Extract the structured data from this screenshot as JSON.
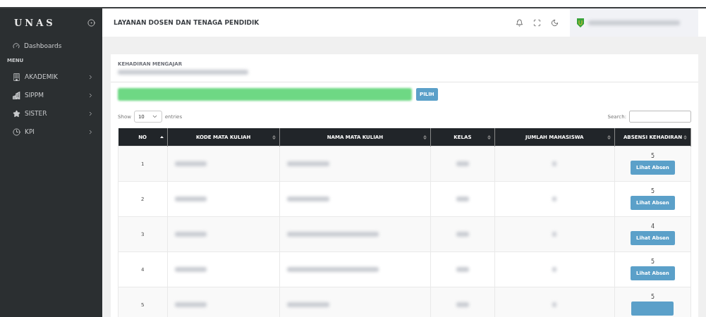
{
  "sidebar": {
    "logo": "UNAS",
    "dashboard": "Dashboards",
    "section": "MENU",
    "items": [
      {
        "label": "AKADEMIK",
        "kind": "building"
      },
      {
        "label": "SIPPM",
        "kind": "office"
      },
      {
        "label": "SISTER",
        "kind": "star"
      },
      {
        "label": "KPI",
        "kind": "clock"
      }
    ]
  },
  "header": {
    "title": "LAYANAN DOSEN DAN TENAGA PENDIDIK"
  },
  "card": {
    "title": "KEHADIRAN MENGAJAR",
    "filter_button": "PILIH",
    "length": {
      "show": "Show",
      "value": "10",
      "entries": "entries"
    },
    "search": {
      "label": "Search:"
    },
    "columns": [
      {
        "label": "NO",
        "sorted": true
      },
      {
        "label": "KODE MATA KULIAH",
        "sorted": false
      },
      {
        "label": "NAMA MATA KULIAH",
        "sorted": false
      },
      {
        "label": "KELAS",
        "sorted": false
      },
      {
        "label": "JUMLAH MAHASISWA",
        "sorted": false
      },
      {
        "label": "ABSENSI KEHADIRAN",
        "sorted": false
      }
    ],
    "rows": [
      {
        "no": "1",
        "count": "5",
        "button": "Lihat Absen"
      },
      {
        "no": "2",
        "count": "5",
        "button": "Lihat Absen"
      },
      {
        "no": "3",
        "count": "4",
        "button": "Lihat Absen"
      },
      {
        "no": "4",
        "count": "5",
        "button": "Lihat Absen"
      },
      {
        "no": "5",
        "count": "5"
      }
    ]
  }
}
